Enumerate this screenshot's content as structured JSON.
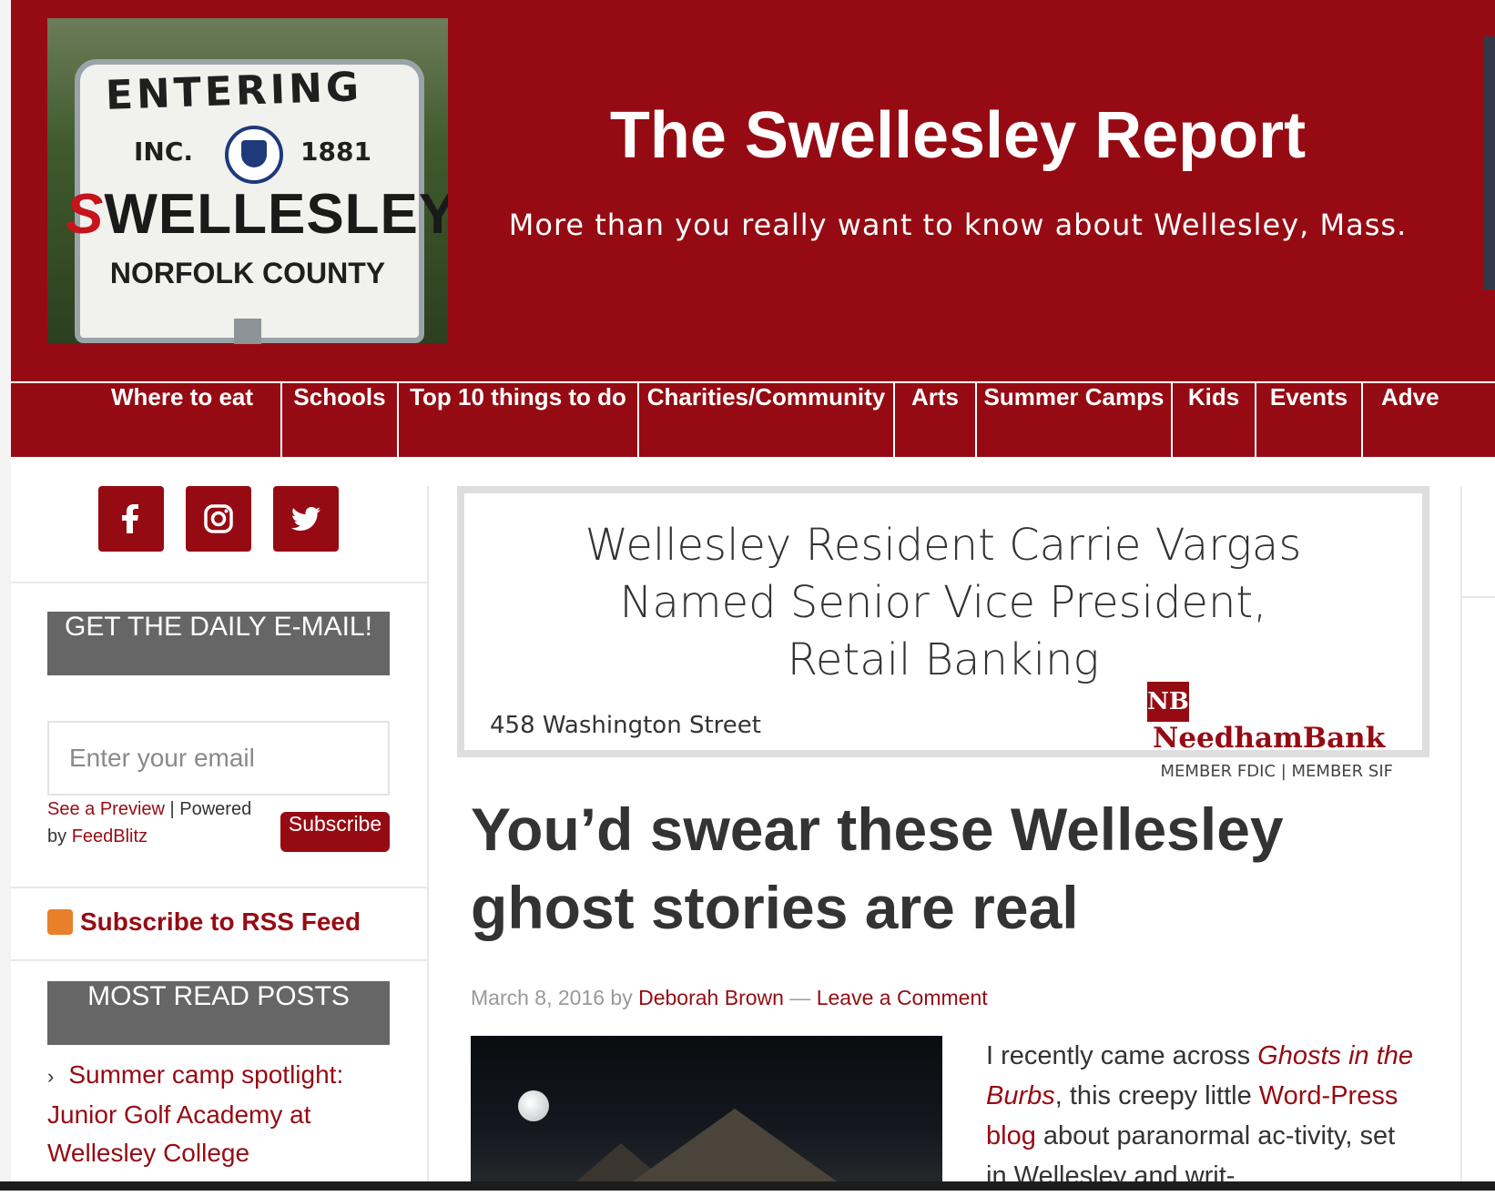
{
  "header": {
    "site_title": "The Swellesley Report",
    "tagline": "More than you really want to know about Wellesley, Mass.",
    "logo": {
      "entering": "ENTERING",
      "inc": "INC.",
      "year": "1881",
      "town_red": "S",
      "town_rest": "WELLESLEY",
      "county": "NORFOLK COUNTY"
    }
  },
  "nav": {
    "items": [
      "Where to eat",
      "Schools",
      "Top 10 things to do",
      "Charities/Community",
      "Arts",
      "Summer Camps",
      "Kids",
      "Events",
      "Adve"
    ]
  },
  "sidebar": {
    "social": [
      "facebook-icon",
      "instagram-icon",
      "twitter-icon"
    ],
    "daily_email_title": "GET THE DAILY E-MAIL!",
    "email_placeholder": "Enter your email",
    "see_preview": "See a Preview",
    "separator": " | Powered by ",
    "feedblitz": "FeedBlitz",
    "subscribe_label": "Subscribe",
    "rss_label": "Subscribe to RSS Feed",
    "most_read_title": "MOST READ POSTS",
    "most_read_items": [
      "Summer camp spotlight: Junior Golf Academy at Wellesley College"
    ]
  },
  "ad": {
    "headline_line1": "Wellesley Resident Carrie Vargas",
    "headline_line2": "Named Senior Vice President,",
    "headline_line3": "Retail Banking",
    "address": "458 Washington Street",
    "bank_mark": "NB",
    "bank_name": "NeedhamBank",
    "member": "MEMBER FDIC | MEMBER SIF"
  },
  "post": {
    "title": "You’d swear these Wellesley ghost stories are real",
    "date": "March 8, 2016",
    "by": " by ",
    "author": "Deborah Brown",
    "dash": " — ",
    "comment_link": "Leave a Comment",
    "text_intro": "I recently came across ",
    "text_link_italic": "Ghosts in the Burbs",
    "text_comma": ", this creepy little ",
    "text_link": "Word-Press blog",
    "text_rest": " about paranormal ac-tivity, set in Wellesley and writ-"
  },
  "colors": {
    "brand": "#960b13",
    "widget_gray": "#666666"
  }
}
